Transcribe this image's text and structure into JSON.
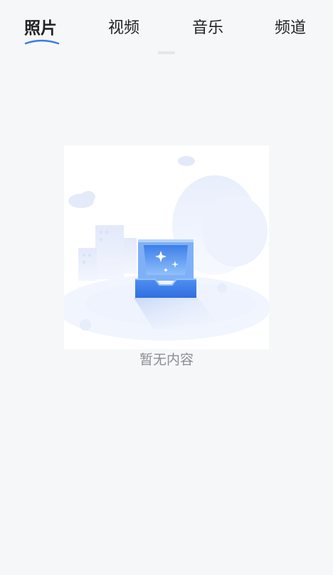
{
  "tabs": [
    {
      "label": "照片",
      "active": true
    },
    {
      "label": "视频",
      "active": false
    },
    {
      "label": "音乐",
      "active": false
    },
    {
      "label": "频道",
      "active": false
    }
  ],
  "empty_state": {
    "message": "暂无内容",
    "icon": "empty-inbox-icon"
  },
  "colors": {
    "background": "#f6f7f9",
    "text_primary": "#222222",
    "text_secondary": "#8a8d93",
    "accent": "#3a7be8"
  }
}
